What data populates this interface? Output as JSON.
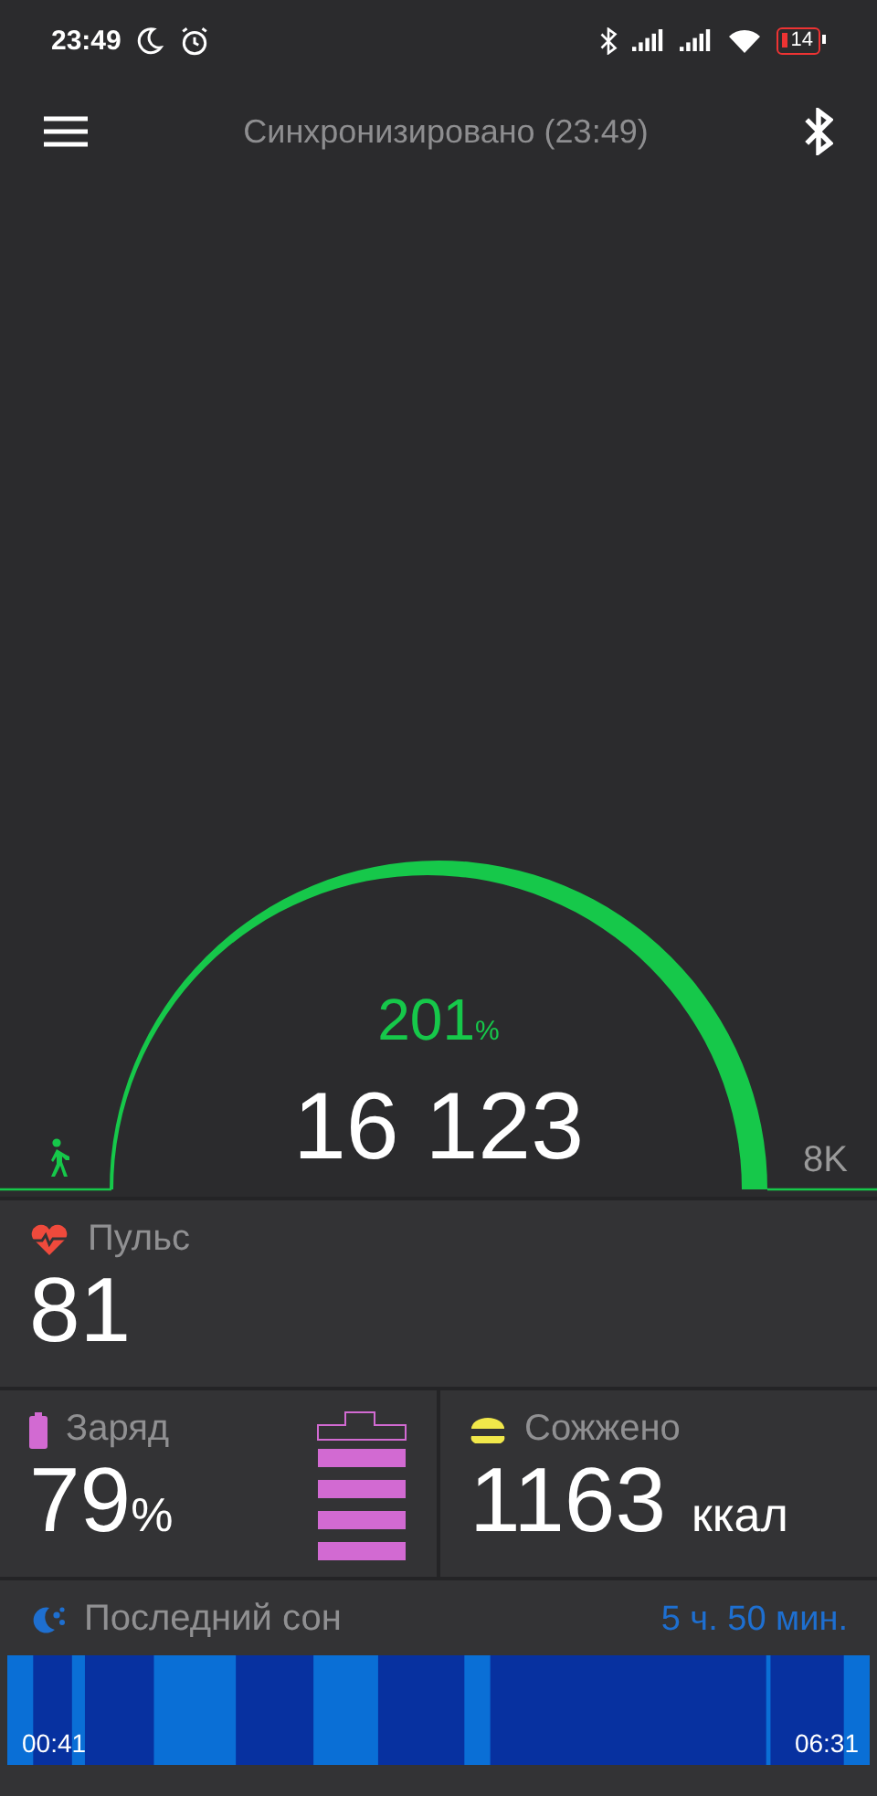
{
  "status_bar": {
    "time": "23:49",
    "battery": "14"
  },
  "header": {
    "title": "Синхронизировано (23:49)"
  },
  "steps": {
    "percent": "201",
    "percent_unit": "%",
    "count": "16 123",
    "goal": "8K"
  },
  "pulse": {
    "label": "Пульс",
    "value": "81"
  },
  "charge": {
    "label": "Заряд",
    "value": "79",
    "unit": "%"
  },
  "burned": {
    "label": "Сожжено",
    "value": "1163",
    "unit": "ккал"
  },
  "sleep": {
    "label": "Последний сон",
    "duration": "5 ч. 50 мин.",
    "start": "00:41",
    "end": "06:31"
  }
}
